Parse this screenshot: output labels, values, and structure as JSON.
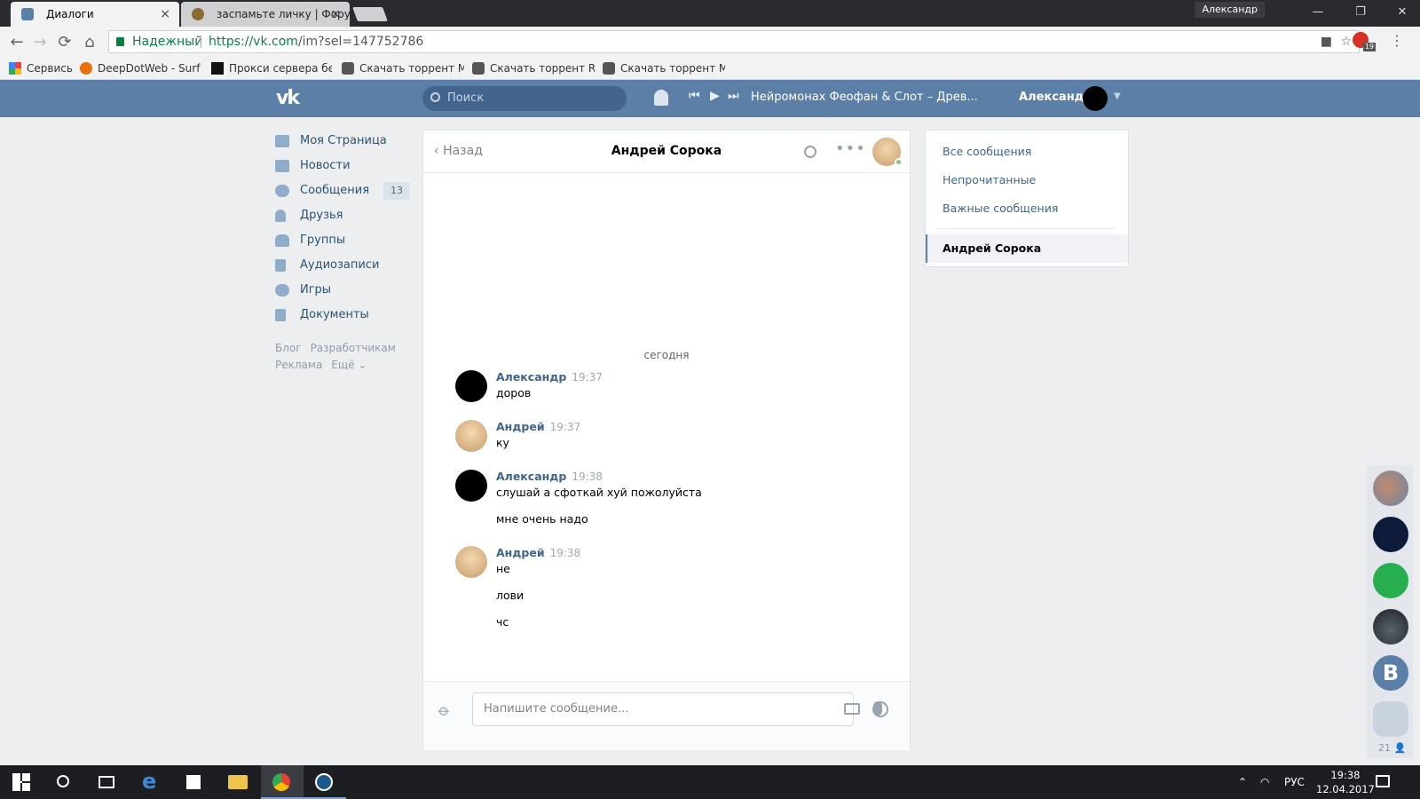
{
  "browser": {
    "tabs": [
      {
        "title": "Диалоги",
        "active": true
      },
      {
        "title": "заспамьте личку | Форум",
        "active": false
      }
    ],
    "close_glyph": "×",
    "profile_name": "Александр",
    "window_controls": {
      "minimize": "—",
      "maximize": "❐",
      "close": "✕"
    },
    "nav": {
      "back": "←",
      "forward": "→",
      "reload": "⟳",
      "home": "⌂"
    },
    "security_label": "Надежный",
    "url_host": "https://vk.com",
    "url_path": "/im?sel=147752786",
    "extension_badge": "19",
    "bookmarks": [
      {
        "label": "Сервисы",
        "icon": "apps-icon"
      },
      {
        "label": "DeepDotWeb - Surfac",
        "icon": "ddw-icon"
      },
      {
        "label": "Прокси сервера бесп",
        "icon": "proxy-icon"
      },
      {
        "label": "Скачать торрент Met",
        "icon": "torrent-icon"
      },
      {
        "label": "Скачать торрент RESI",
        "icon": "torrent-icon"
      },
      {
        "label": "Скачать торрент Mas",
        "icon": "torrent-icon"
      }
    ]
  },
  "vk": {
    "logo": "vk",
    "search_placeholder": "Поиск",
    "player": {
      "track": "Нейромонах Феофан & Слот – Древ...",
      "prev": "⏮",
      "play": "▶",
      "next": "⏭"
    },
    "user_name": "Александр",
    "left_menu": [
      {
        "label": "Моя Страница",
        "icon": "home-icon"
      },
      {
        "label": "Новости",
        "icon": "news-icon"
      },
      {
        "label": "Сообщения",
        "icon": "messages-icon",
        "count": "13"
      },
      {
        "label": "Друзья",
        "icon": "friends-icon"
      },
      {
        "label": "Группы",
        "icon": "groups-icon"
      },
      {
        "label": "Аудиозаписи",
        "icon": "music-icon"
      },
      {
        "label": "Игры",
        "icon": "games-icon"
      },
      {
        "label": "Документы",
        "icon": "documents-icon"
      }
    ],
    "footer_links": [
      "Блог",
      "Разработчикам",
      "Реклама",
      "Ещё ⌄"
    ],
    "chat": {
      "back_label": "Назад",
      "title": "Андрей Сорока",
      "day_separator": "сегодня",
      "messages": [
        {
          "author": "Александр",
          "time": "19:37",
          "lines": [
            "доров"
          ]
        },
        {
          "author": "Андрей",
          "time": "19:37",
          "lines": [
            "ку"
          ]
        },
        {
          "author": "Александр",
          "time": "19:38",
          "lines": [
            "слушай а сфоткай хуй пожолуйста",
            "мне очень надо"
          ]
        },
        {
          "author": "Андрей",
          "time": "19:38",
          "lines": [
            "не",
            "лови",
            "чс"
          ]
        }
      ],
      "composer_placeholder": "Напишите сообщение..."
    },
    "right_menu": {
      "items": [
        "Все сообщения",
        "Непрочитанные",
        "Важные сообщения"
      ],
      "selected": "Андрей Сорока"
    },
    "rail": {
      "b_letter": "B",
      "online_count": "21 👤"
    }
  },
  "taskbar": {
    "language": "РУС",
    "time": "19:38",
    "date": "12.04.2017"
  },
  "colors": {
    "vk_blue": "#5b7fa6",
    "link": "#42648b",
    "secure_green": "#0b8043"
  }
}
